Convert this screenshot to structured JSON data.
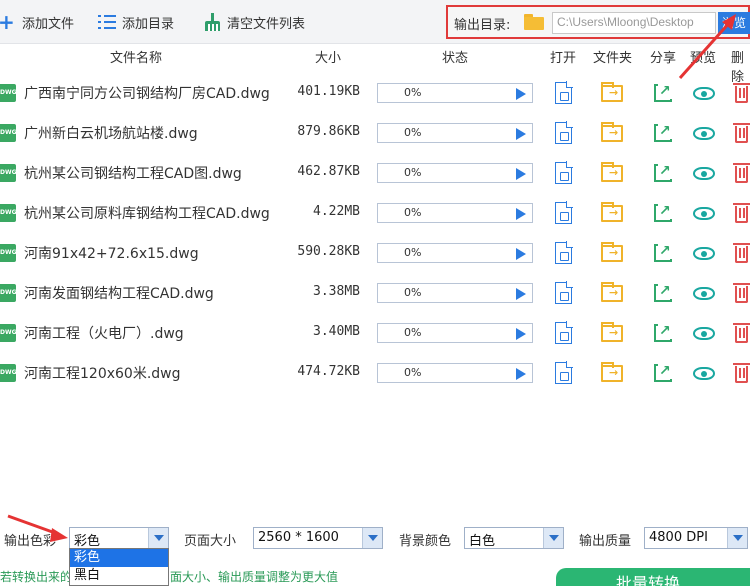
{
  "toolbar": {
    "add_file": "添加文件",
    "add_dir": "添加目录",
    "clear_list": "清空文件列表",
    "output_label": "输出目录:",
    "output_path": "C:\\Users\\Mloong\\Desktop",
    "browse": "浏览"
  },
  "columns": {
    "name": "文件名称",
    "size": "大小",
    "status": "状态",
    "open": "打开",
    "folder": "文件夹",
    "share": "分享",
    "preview": "预览",
    "delete": "删除"
  },
  "files": [
    {
      "name": "广西南宁同方公司钢结构厂房CAD.dwg",
      "size": "401.19KB",
      "progress": "0%"
    },
    {
      "name": "广州新白云机场航站楼.dwg",
      "size": "879.86KB",
      "progress": "0%"
    },
    {
      "name": "杭州某公司钢结构工程CAD图.dwg",
      "size": "462.87KB",
      "progress": "0%"
    },
    {
      "name": "杭州某公司原料库钢结构工程CAD.dwg",
      "size": "4.22MB",
      "progress": "0%"
    },
    {
      "name": "河南91x42+72.6x15.dwg",
      "size": "590.28KB",
      "progress": "0%"
    },
    {
      "name": "河南发面钢结构工程CAD.dwg",
      "size": "3.38MB",
      "progress": "0%"
    },
    {
      "name": "河南工程（火电厂）.dwg",
      "size": "3.40MB",
      "progress": "0%"
    },
    {
      "name": "河南工程120x60米.dwg",
      "size": "474.72KB",
      "progress": "0%"
    }
  ],
  "file_badge": "DWG",
  "settings": {
    "color_label": "输出色彩",
    "color_value": "彩色",
    "page_size_label": "页面大小",
    "page_size_value": "2560 * 1600",
    "bg_label": "背景颜色",
    "bg_value": "白色",
    "quality_label": "输出质量",
    "quality_value": "4800 DPI"
  },
  "dropdown": {
    "options": [
      "彩色",
      "黑白"
    ],
    "selected_index": 0
  },
  "hint": {
    "left": "若转换出来的",
    "right": "面大小、输出质量调整为更大值"
  },
  "convert_button": "批量转换",
  "colors": {
    "accent": "#2b7be0",
    "highlight_red": "#e03a3a",
    "green": "#2bb673"
  }
}
